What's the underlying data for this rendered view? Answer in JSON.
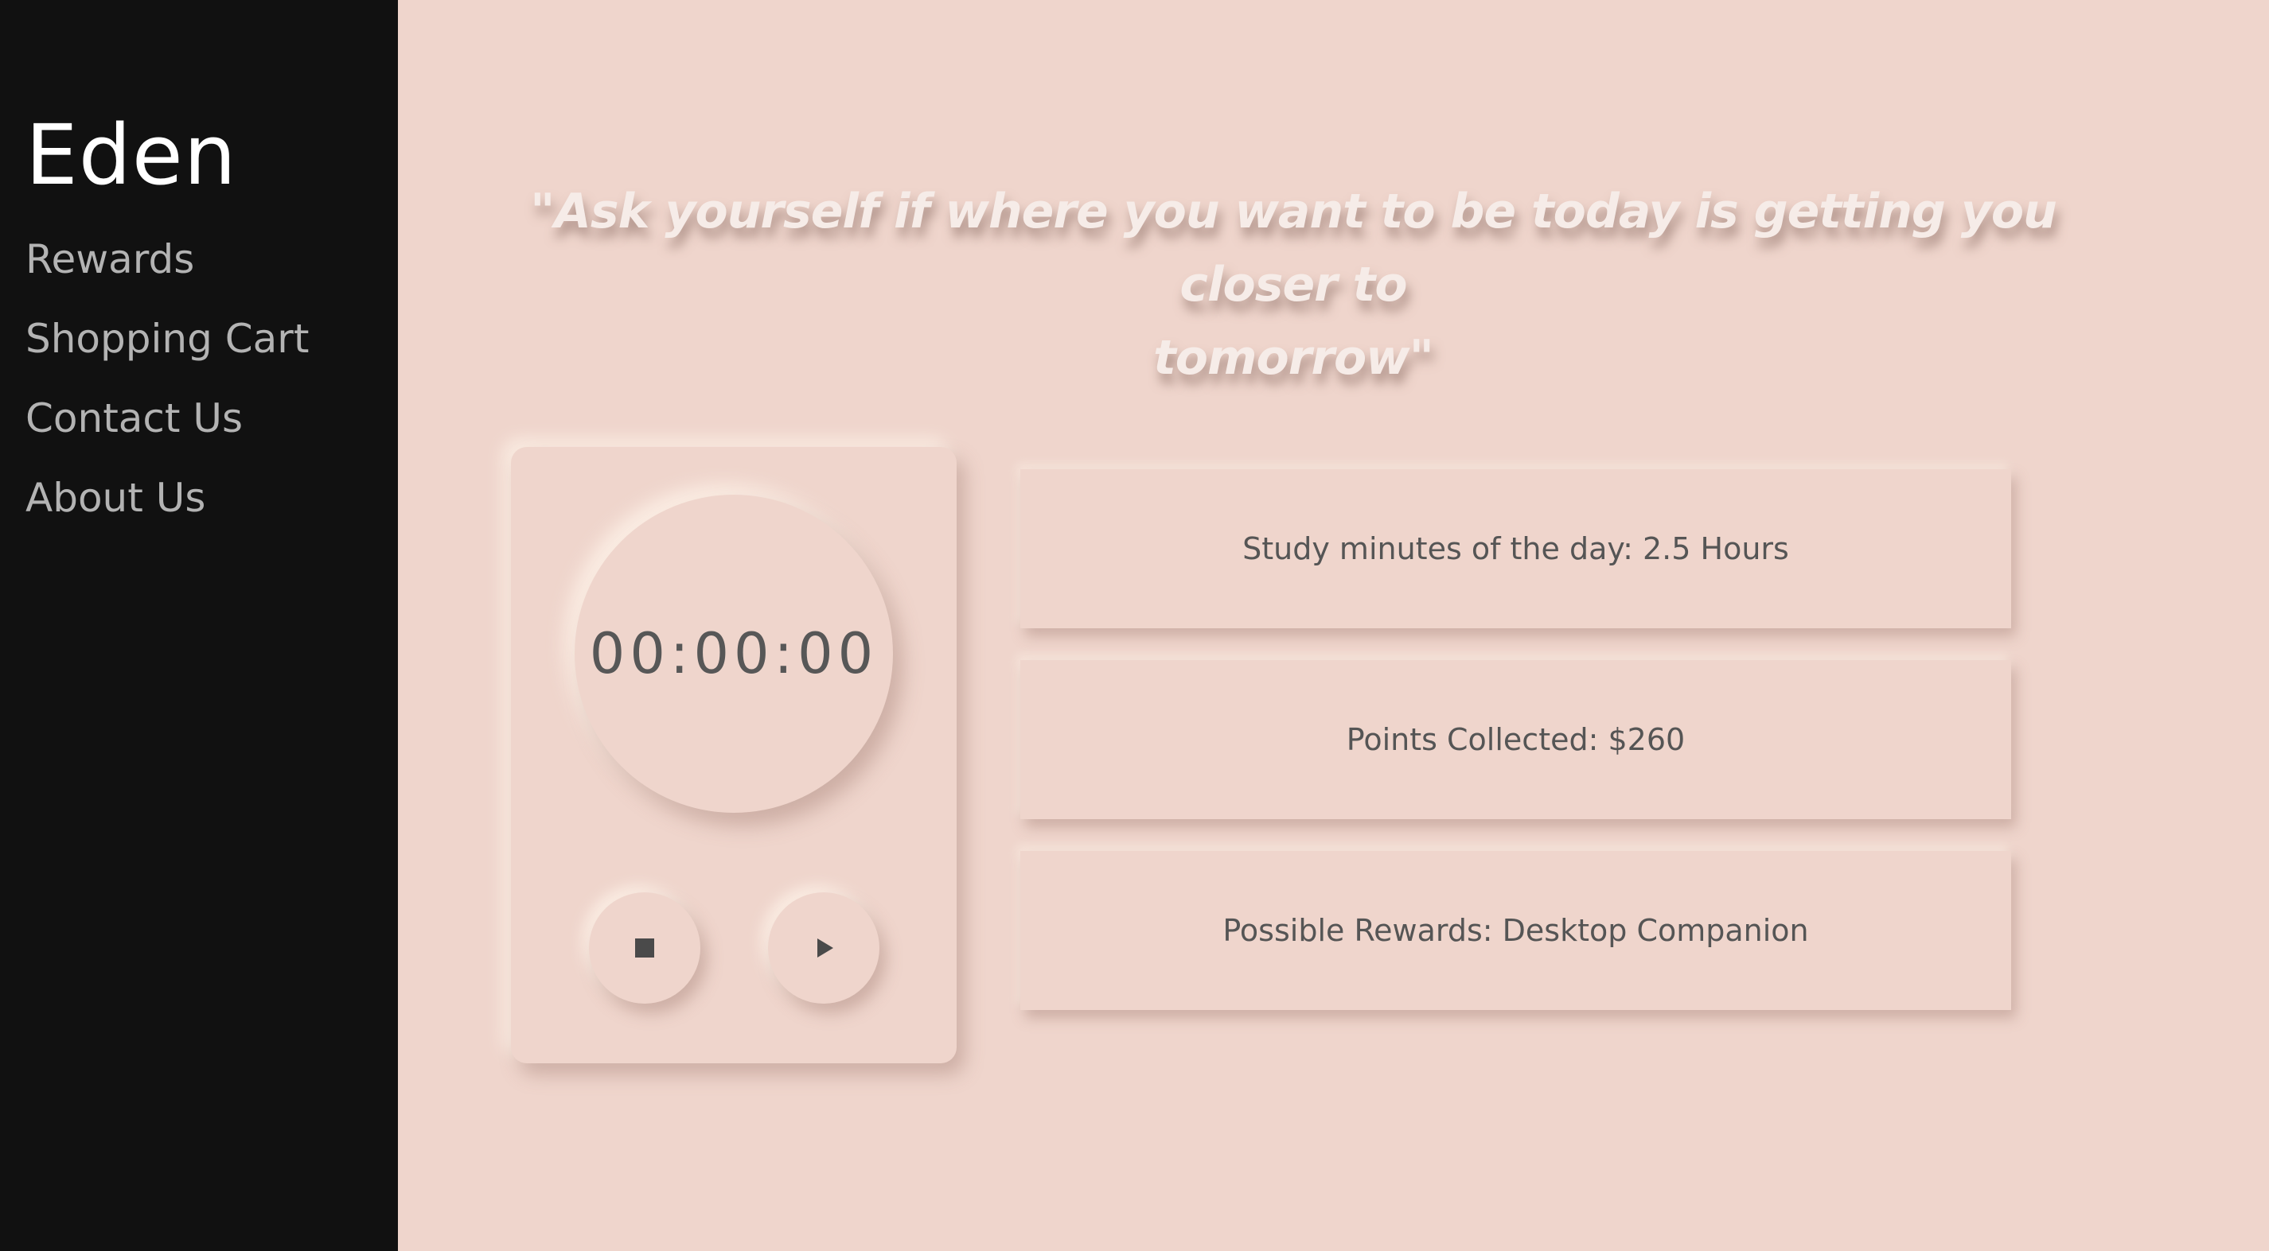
{
  "sidebar": {
    "brand": "Eden",
    "items": [
      {
        "label": "Rewards"
      },
      {
        "label": "Shopping Cart"
      },
      {
        "label": "Contact Us"
      },
      {
        "label": "About Us"
      }
    ]
  },
  "main": {
    "quote_line1": "\"Ask yourself if where you want to be today is getting you closer to",
    "quote_line2": "tomorrow\"",
    "timer": {
      "display": "00:00:00",
      "stop_icon": "stop-icon",
      "play_icon": "play-icon"
    },
    "stats": [
      {
        "text": "Study minutes of the day: 2.5 Hours"
      },
      {
        "text": "Points Collected: $260"
      },
      {
        "text": "Possible Rewards: Desktop Companion"
      }
    ]
  },
  "colors": {
    "sidebar_bg": "#111111",
    "page_bg": "#efd5cc",
    "nav_text": "#b3b3b3",
    "brand_text": "#ffffff",
    "body_text": "#555555"
  }
}
